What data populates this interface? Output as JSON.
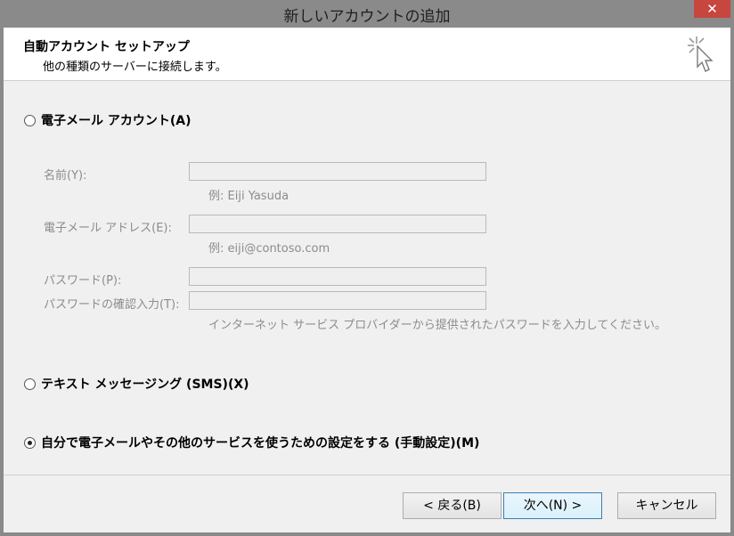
{
  "window": {
    "title": "新しいアカウントの追加",
    "close_glyph": "✕"
  },
  "header": {
    "title": "自動アカウント セットアップ",
    "subtitle": "他の種類のサーバーに接続します。"
  },
  "options": {
    "email_account": "電子メール アカウント(A)",
    "sms": "テキスト メッセージング (SMS)(X)",
    "manual": "自分で電子メールやその他のサービスを使うための設定をする (手動設定)(M)",
    "selected": "manual"
  },
  "form": {
    "name_label": "名前(Y):",
    "name_hint": "例: Eiji Yasuda",
    "email_label": "電子メール アドレス(E):",
    "email_hint": "例: eiji@contoso.com",
    "password_label": "パスワード(P):",
    "password_confirm_label": "パスワードの確認入力(T):",
    "password_hint": "インターネット サービス プロバイダーから提供されたパスワードを入力してください。"
  },
  "buttons": {
    "back": "< 戻る(B)",
    "next": "次へ(N) >",
    "cancel": "キャンセル"
  },
  "icons": {
    "close": "close-icon",
    "wizard": "wizard-cursor-icon"
  }
}
